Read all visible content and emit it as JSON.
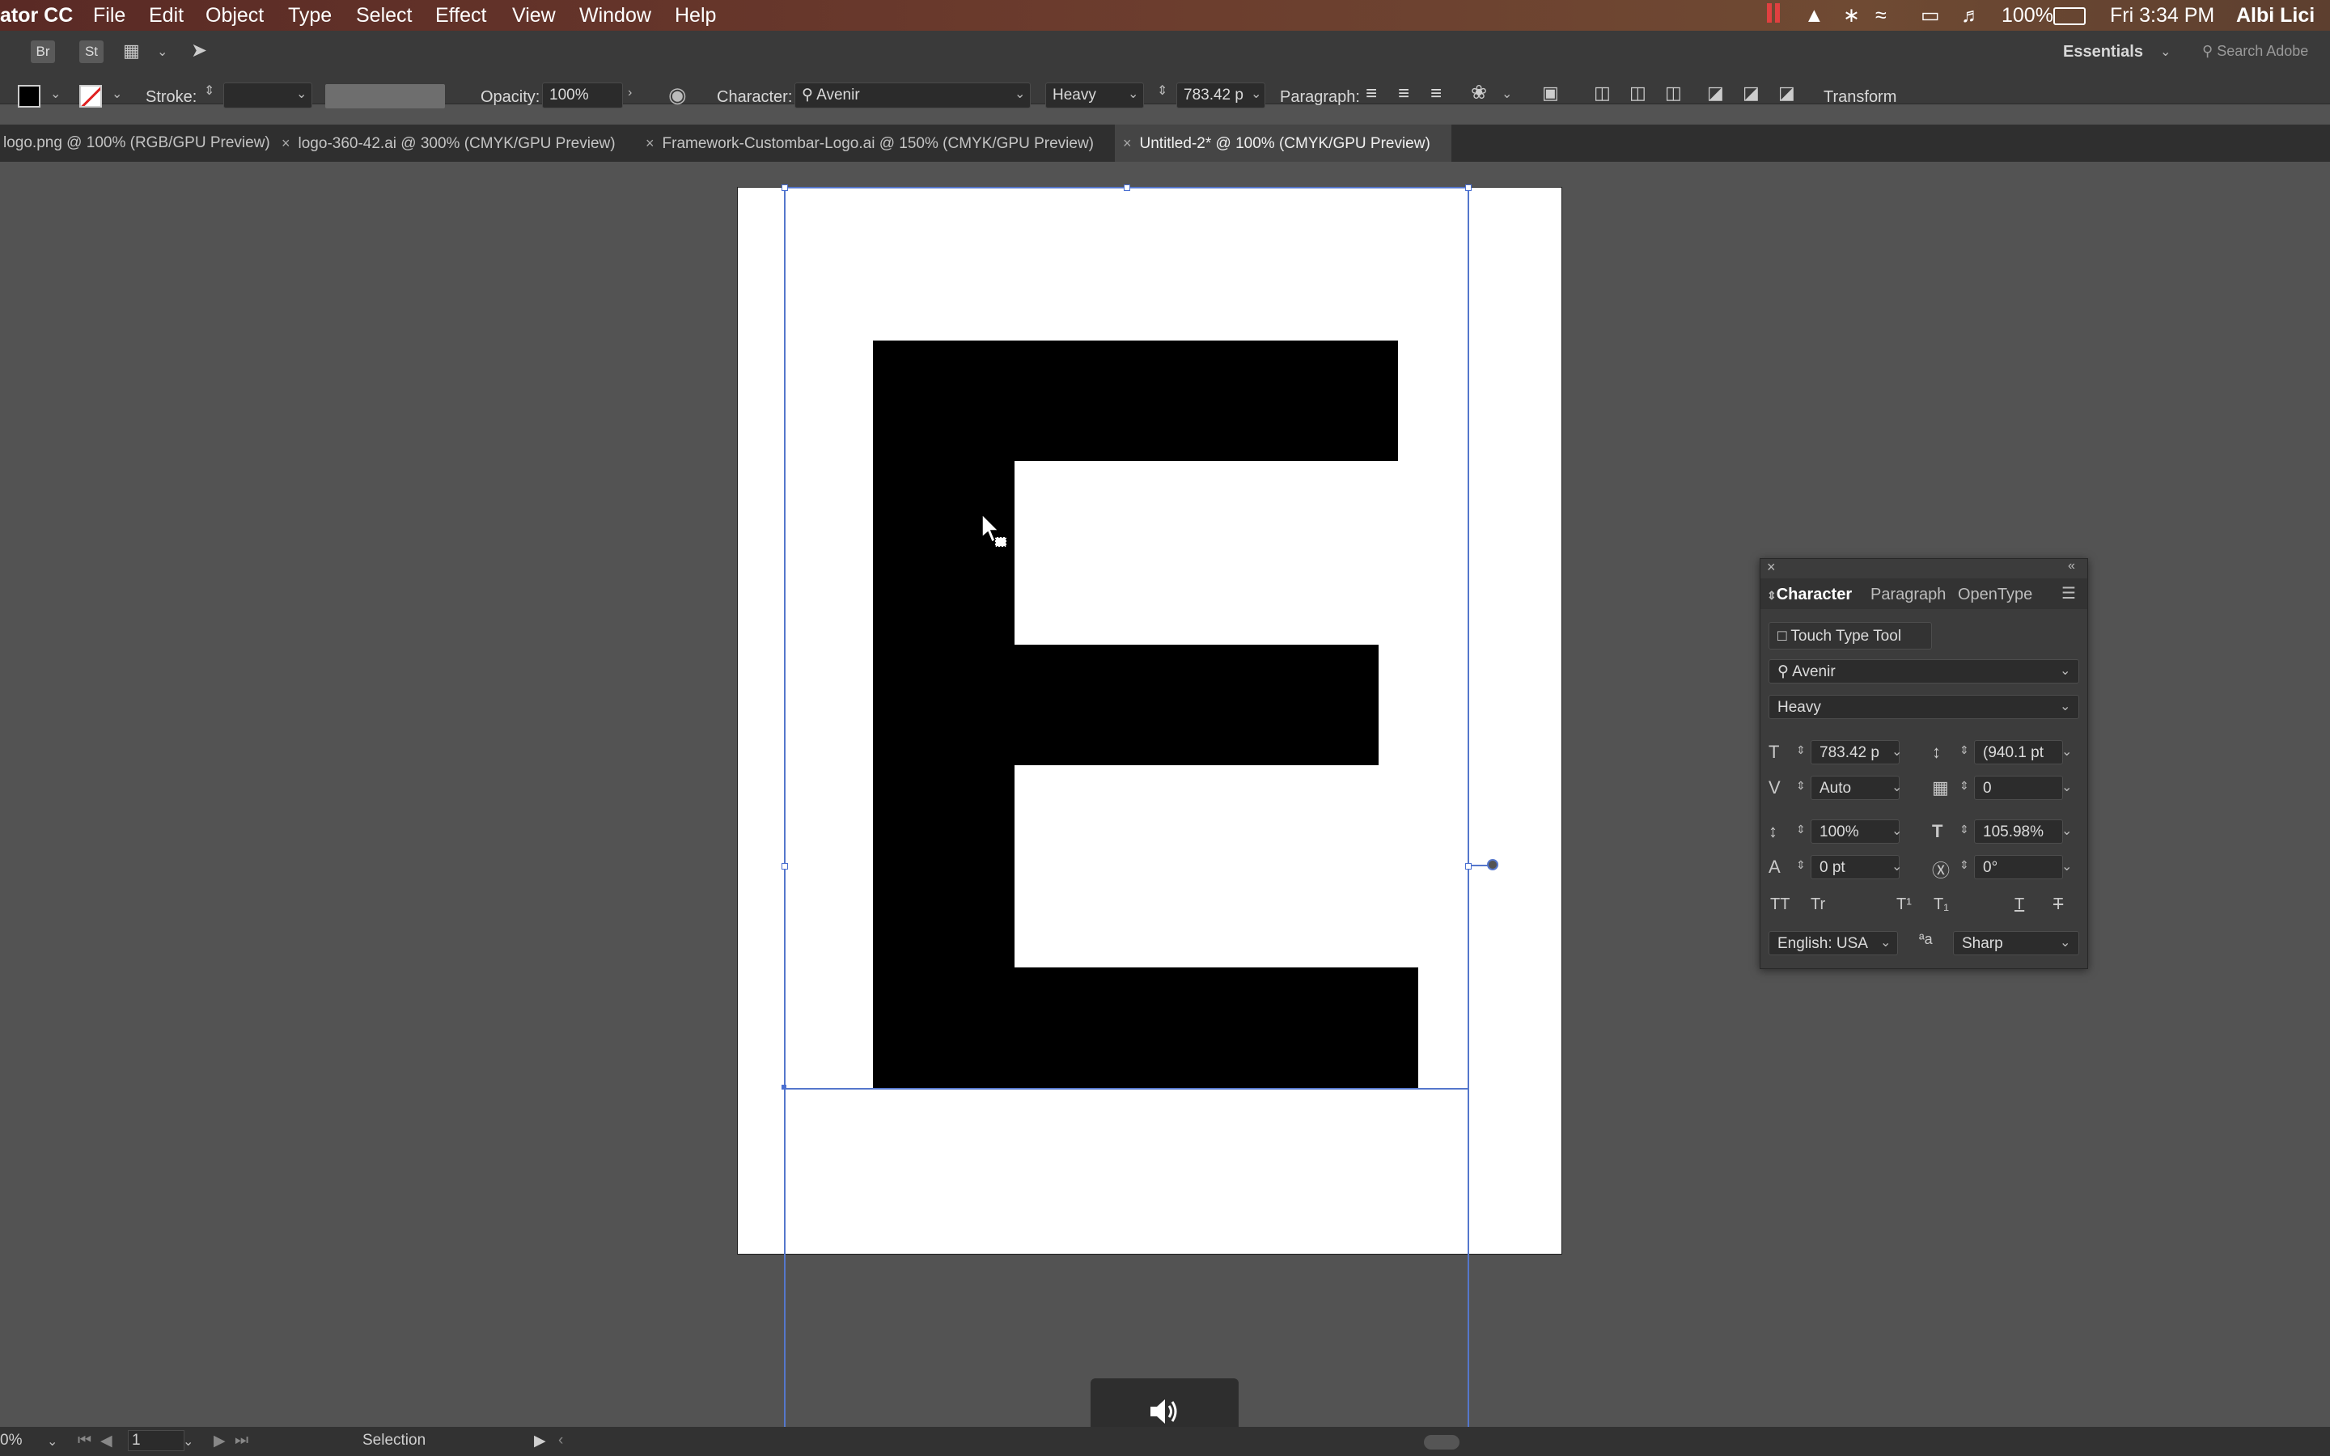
{
  "menubar": {
    "app_name": "ator CC",
    "menus": [
      "File",
      "Edit",
      "Object",
      "Type",
      "Select",
      "Effect",
      "View",
      "Window",
      "Help"
    ],
    "battery": "100%",
    "clock": "Fri 3:34 PM",
    "user": "Albi Lici"
  },
  "appbar": {
    "bridge": "Br",
    "stock": "St",
    "workspace": "Essentials",
    "search_placeholder": "Search Adobe"
  },
  "controlbar": {
    "stroke_label": "Stroke:",
    "opacity_label": "Opacity:",
    "opacity_value": "100%",
    "character_label": "Character:",
    "font_family": "Avenir",
    "font_style": "Heavy",
    "font_size": "783.42 p",
    "paragraph_label": "Paragraph:",
    "transform_label": "Transform"
  },
  "tabs": [
    {
      "label": "logo.png @ 100% (RGB/GPU Preview)"
    },
    {
      "label": "logo-360-42.ai @ 300% (CMYK/GPU Preview)"
    },
    {
      "label": "Framework-Custombar-Logo.ai @ 150% (CMYK/GPU Preview)"
    },
    {
      "label": "Untitled-2* @ 100% (CMYK/GPU Preview)"
    }
  ],
  "artwork": {
    "glyph": "E"
  },
  "character_panel": {
    "tabs": [
      "Character",
      "Paragraph",
      "OpenType"
    ],
    "touch_type": "Touch Type Tool",
    "font_family": "Avenir",
    "font_style": "Heavy",
    "font_size": "783.42 p",
    "leading": "(940.1 pt",
    "kerning": "Auto",
    "tracking": "0",
    "vertical_scale": "100%",
    "horizontal_scale": "105.98%",
    "baseline_shift": "0 pt",
    "rotation": "0°",
    "language": "English: USA",
    "antialias": "Sharp",
    "aa_icon": "ªa"
  },
  "statusbar": {
    "zoom": "0%",
    "artboard_number": "1",
    "tool": "Selection"
  },
  "colors": {
    "accent_guide": "#5577cc",
    "panel_bg": "#3c3c3c",
    "canvas_bg": "#535353"
  }
}
